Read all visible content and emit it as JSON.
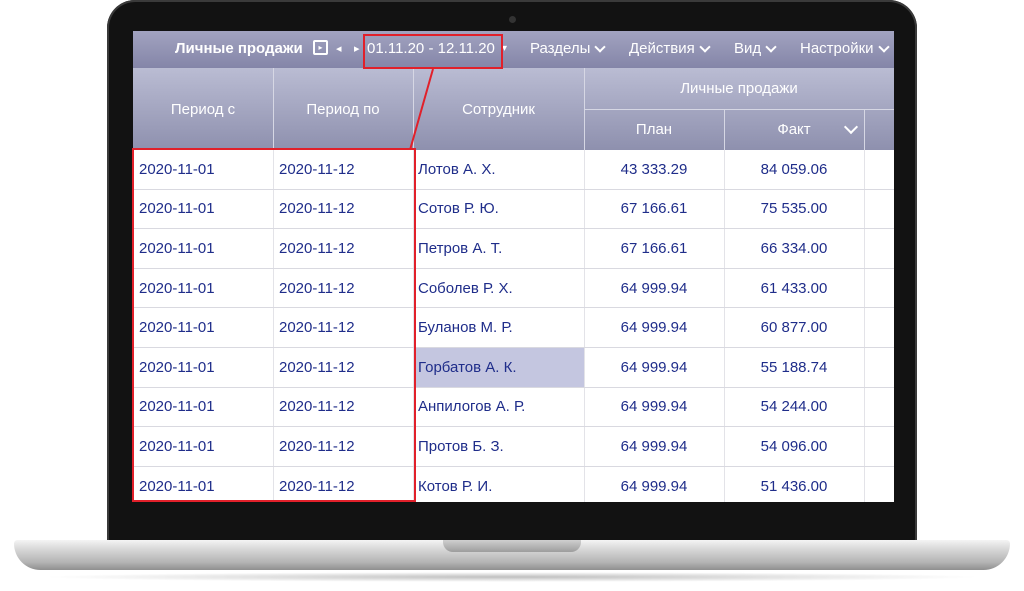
{
  "toolbar": {
    "title": "Личные продажи",
    "calendar_icon": "calendar-icon",
    "prev_icon": "◂",
    "next_icon": "▸",
    "period": "01.11.20 - 12.11.20",
    "period_dropdown_icon": "▾",
    "menus": [
      "Разделы",
      "Действия",
      "Вид",
      "Настройки"
    ]
  },
  "table": {
    "headers": {
      "period_from": "Период с",
      "period_to": "Период по",
      "employee": "Сотрудник",
      "group": "Личные продажи",
      "plan": "План",
      "fact": "Факт"
    },
    "rows": [
      {
        "from": "2020-11-01",
        "to": "2020-11-12",
        "employee": "Лотов А. Х.",
        "plan": "43 333.29",
        "fact": "84 059.06"
      },
      {
        "from": "2020-11-01",
        "to": "2020-11-12",
        "employee": "Сотов Р. Ю.",
        "plan": "67 166.61",
        "fact": "75 535.00"
      },
      {
        "from": "2020-11-01",
        "to": "2020-11-12",
        "employee": "Петров А. Т.",
        "plan": "67 166.61",
        "fact": "66 334.00"
      },
      {
        "from": "2020-11-01",
        "to": "2020-11-12",
        "employee": "Соболев Р. Х.",
        "plan": "64 999.94",
        "fact": "61 433.00"
      },
      {
        "from": "2020-11-01",
        "to": "2020-11-12",
        "employee": "Буланов М. Р.",
        "plan": "64 999.94",
        "fact": "60 877.00"
      },
      {
        "from": "2020-11-01",
        "to": "2020-11-12",
        "employee": "Горбатов А. К.",
        "plan": "64 999.94",
        "fact": "55 188.74",
        "selected": true
      },
      {
        "from": "2020-11-01",
        "to": "2020-11-12",
        "employee": "Анпилогов А. Р.",
        "plan": "64 999.94",
        "fact": "54 244.00"
      },
      {
        "from": "2020-11-01",
        "to": "2020-11-12",
        "employee": "Протов Б. З.",
        "plan": "64 999.94",
        "fact": "54 096.00"
      },
      {
        "from": "2020-11-01",
        "to": "2020-11-12",
        "employee": "Котов Р. И.",
        "plan": "64 999.94",
        "fact": "51 436.00"
      }
    ]
  },
  "colors": {
    "highlight": "#e1202a",
    "toolbar": "#8485a8",
    "row_text": "#1f2d8a",
    "selected_row": "#c4c6e0"
  }
}
